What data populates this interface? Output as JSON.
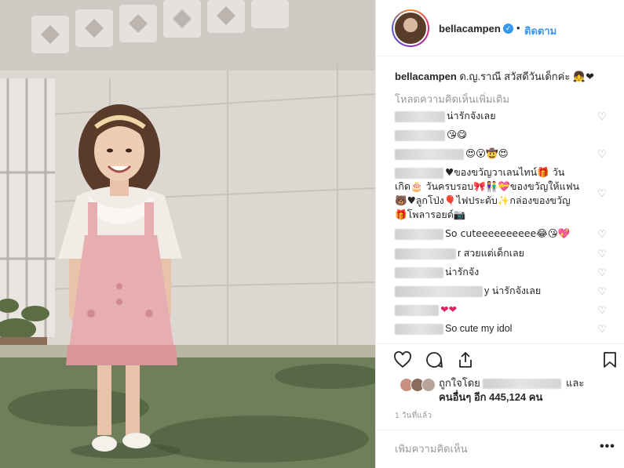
{
  "post": {
    "username": "bellacampen",
    "follow_label": "ติดตาม",
    "separator": "•",
    "verified_glyph": "✓"
  },
  "caption": {
    "username": "bellacampen",
    "text": " ด.ญ.ราณี สวัสดีวันเด็กค่ะ 👧❤"
  },
  "load_more_label": "โหลดความคิดเห็นเพิ่มเติม",
  "comments": [
    {
      "text": "น่ารักจังเลย"
    },
    {
      "text": "😘😋"
    },
    {
      "text": "😍😮🤠😍"
    },
    {
      "text": "♥ของขวัญวาเลนไทน์🎁 วันเกิด🎂 วันครบรอบ🎀👫💝ของขวัญให้แฟน🐻♥ลูกโป่ง🎈ไฟประดับ✨กล่องของขวัญ🎁โพลารอยด์📷"
    },
    {
      "text": "So cuteeeeeeeeee😂😘💖"
    },
    {
      "text": "r สวยแต่เด็กเลย"
    },
    {
      "text": "น่ารักจัง"
    },
    {
      "text": "y น่ารักจังเลย"
    },
    {
      "text": "❤❤"
    },
    {
      "text": "So cute my idol"
    }
  ],
  "likes": {
    "prefix": "ถูกใจโดย",
    "suffix": "และ",
    "line2": "คนอื่นๆ อีก 445,124 คน"
  },
  "timestamp": "1 วันที่แล้ว",
  "add_comment_placeholder": "เพิ่มความคิดเห็น",
  "more_options_label": "•••",
  "icons": {
    "heart": "heart-icon",
    "comment": "comment-icon",
    "share": "share-icon",
    "bookmark": "bookmark-icon"
  },
  "colors": {
    "accent": "#3897f0",
    "muted": "#999999",
    "text": "#262626",
    "border": "#efefef"
  }
}
